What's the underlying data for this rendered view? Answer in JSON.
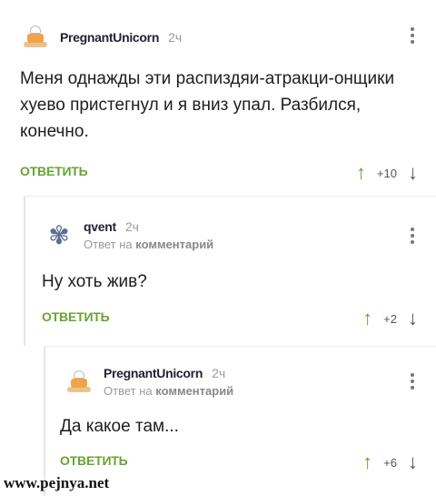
{
  "comments": [
    {
      "username": "PregnantUnicorn",
      "time": "2ч",
      "text": "Меня однажды эти распиздяи-атракци-онщики хуево пристегнул и я вниз упал. Разбился, конечно.",
      "reply_label": "ОТВЕТИТЬ",
      "score": "+10",
      "avatar_icon": "cake-avatar-icon"
    },
    {
      "username": "qvent",
      "time": "2ч",
      "reply_to": "Ответ на",
      "reply_to_target": "комментарий",
      "text": "Ну хоть жив?",
      "reply_label": "ОТВЕТИТЬ",
      "score": "+2",
      "avatar_icon": "snowflake-avatar-icon"
    },
    {
      "username": "PregnantUnicorn",
      "time": "2ч",
      "reply_to": "Ответ на",
      "reply_to_target": "комментарий",
      "text": "Да какое там...",
      "reply_label": "ОТВЕТИТЬ",
      "score": "+6",
      "avatar_icon": "cake-avatar-icon"
    }
  ],
  "watermark": "www.pejnya.net",
  "colors": {
    "reply": "#69a332",
    "upvote": "#6aa234",
    "muted": "#9a9a9a"
  }
}
